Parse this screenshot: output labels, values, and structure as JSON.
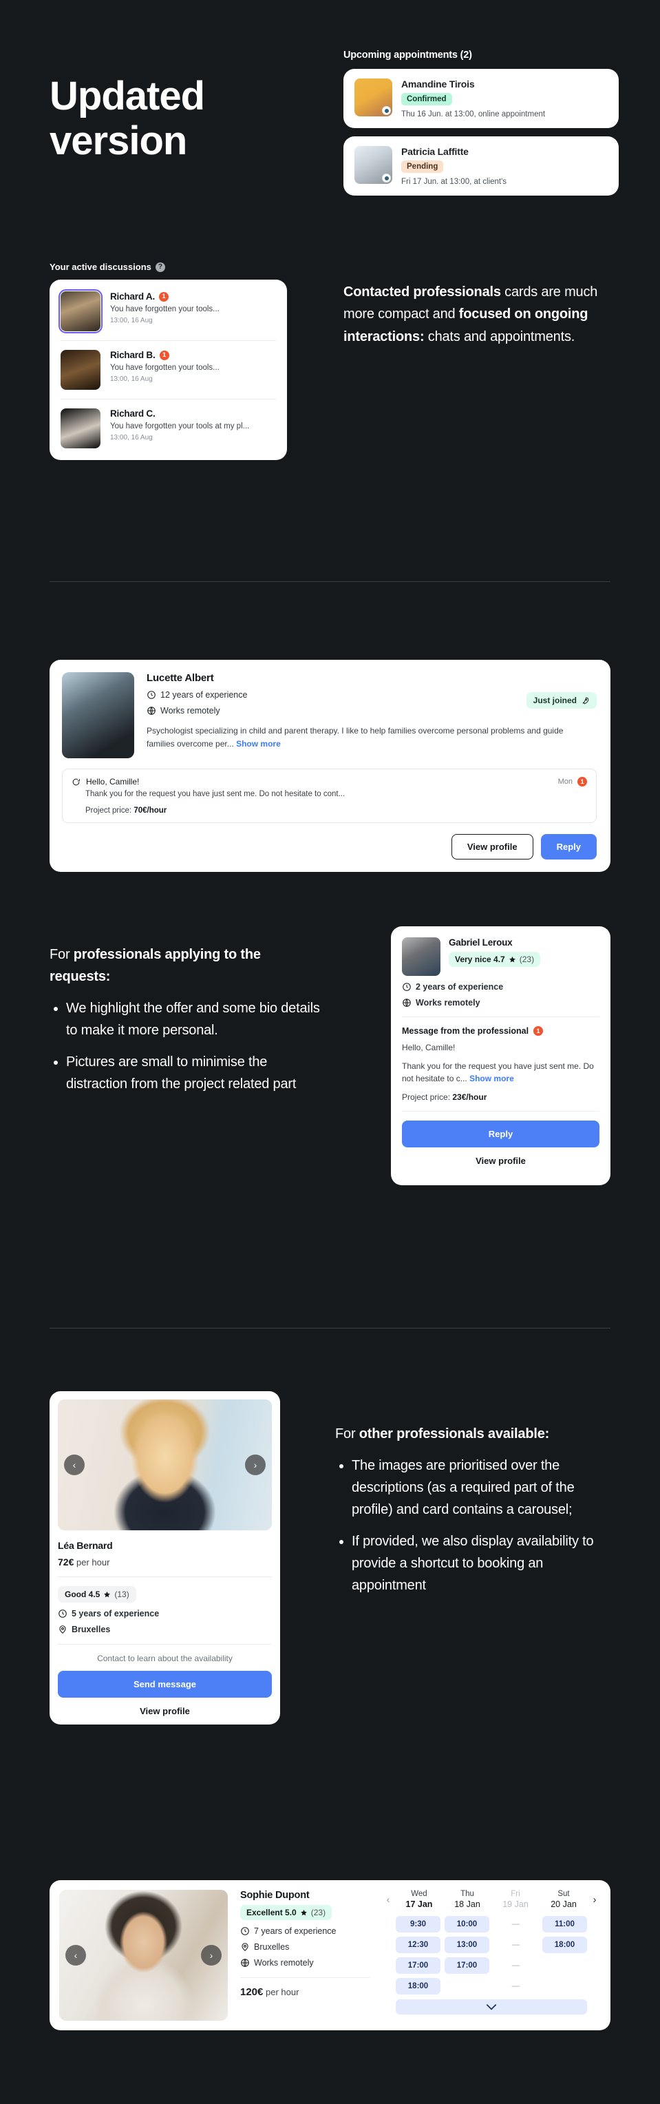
{
  "hero": {
    "title": "Updated version"
  },
  "appointments": {
    "heading": "Upcoming appointments (2)",
    "items": [
      {
        "name": "Amandine Tirois",
        "status": "Confirmed",
        "status_kind": "confirmed",
        "when": "Thu 16 Jun. at 13:00, online appointment"
      },
      {
        "name": "Patricia Laffitte",
        "status": "Pending",
        "status_kind": "pending",
        "when": "Fri 17 Jun. at 13:00, at client's"
      }
    ]
  },
  "discussions": {
    "heading": "Your active discussions",
    "help_glyph": "?",
    "items": [
      {
        "name": "Richard A.",
        "unread": "1",
        "preview": "You have forgotten your tools...",
        "time": "13:00, 16 Aug"
      },
      {
        "name": "Richard B.",
        "unread": "1",
        "preview": "You have forgotten your tools...",
        "time": "13:00, 16 Aug"
      },
      {
        "name": "Richard C.",
        "unread": "",
        "preview": "You have forgotten your tools at my pl...",
        "time": "13:00, 16 Aug"
      }
    ]
  },
  "copy": {
    "block1": {
      "bold1": "Contacted professionals",
      "text1": " cards are much more compact and ",
      "bold2": "focused on ongoing interactions:",
      "text2": " chats and appointments."
    },
    "block2": {
      "lead_plain": "For ",
      "lead_bold": "professionals applying to the requests:",
      "bullets": [
        "We highlight the offer and some bio details to make it more personal.",
        "Pictures are small to minimise the distraction from the project related part"
      ]
    },
    "block3": {
      "lead_plain": "For ",
      "lead_bold": "other professionals available:",
      "bullets": [
        "The images are prioritised over the descriptions (as a required part of the profile) and card contains a carousel;",
        "If provided, we also display availability to provide a shortcut to booking an appointment"
      ]
    }
  },
  "lucette": {
    "name": "Lucette Albert",
    "experience": "12 years of experience",
    "remote": "Works remotely",
    "bio": "Psychologist specializing in child and parent therapy. I like to help families overcome personal problems and guide families overcome per...",
    "show_more": "Show more",
    "badge": "Just joined",
    "msg_hello": "Hello, Camille!",
    "msg_body": "Thank you for the request you have just sent me. Do not hesitate to cont...",
    "msg_day": "Mon",
    "msg_unread": "1",
    "price_label": "Project price:",
    "price_value": "70€/hour",
    "btn_view": "View profile",
    "btn_reply": "Reply"
  },
  "gabriel": {
    "name": "Gabriel Leroux",
    "rating_label": "Very nice 4.7",
    "rating_count": "(23)",
    "experience": "2 years of experience",
    "remote": "Works remotely",
    "msg_heading": "Message from the professional",
    "msg_unread": "1",
    "msg_hello": "Hello, Camille!",
    "msg_body": "Thank you for the request you have just sent me. Do not hesitate to c...",
    "show_more": "Show more",
    "price_label": "Project price:",
    "price_value": "23€/hour",
    "btn_reply": "Reply",
    "btn_view": "View profile"
  },
  "lea": {
    "name": "Léa Bernard",
    "price_value": "72€",
    "price_unit": "per hour",
    "rating_label": "Good 4.5",
    "rating_count": "(13)",
    "experience": "5 years of experience",
    "location": "Bruxelles",
    "availability_note": "Contact to learn about the availability",
    "btn_send": "Send message",
    "btn_view": "View profile",
    "prev": "‹",
    "next": "›"
  },
  "sophie": {
    "name": "Sophie Dupont",
    "rating_label": "Excellent 5.0",
    "rating_count": "(23)",
    "experience": "7 years of experience",
    "location": "Bruxelles",
    "remote": "Works remotely",
    "price_value": "120€",
    "price_unit": "per hour",
    "prev": "‹",
    "next": "›",
    "schedule": {
      "prev": "‹",
      "next": "›",
      "days": [
        {
          "weekday": "Wed",
          "date": "17 Jan",
          "selected": true,
          "disabled": false,
          "slots": [
            "9:30",
            "12:30",
            "17:00",
            "18:00"
          ]
        },
        {
          "weekday": "Thu",
          "date": "18 Jan",
          "selected": false,
          "disabled": false,
          "slots": [
            "10:00",
            "13:00",
            "17:00"
          ]
        },
        {
          "weekday": "Fri",
          "date": "19 Jan",
          "selected": false,
          "disabled": true,
          "slots": [
            "—",
            "—",
            "—",
            "—"
          ]
        },
        {
          "weekday": "Sut",
          "date": "20 Jan",
          "selected": false,
          "disabled": false,
          "slots": [
            "11:00",
            "18:00"
          ]
        }
      ],
      "expand_glyph": "⌄"
    }
  },
  "colors": {
    "bg": "#16191c",
    "card": "#ffffff",
    "primary": "#4d80f7",
    "badge_green": "#ddfaee",
    "badge_orange": "#fbe0cb",
    "unread": "#f2542d",
    "slot": "#e3eafd"
  }
}
